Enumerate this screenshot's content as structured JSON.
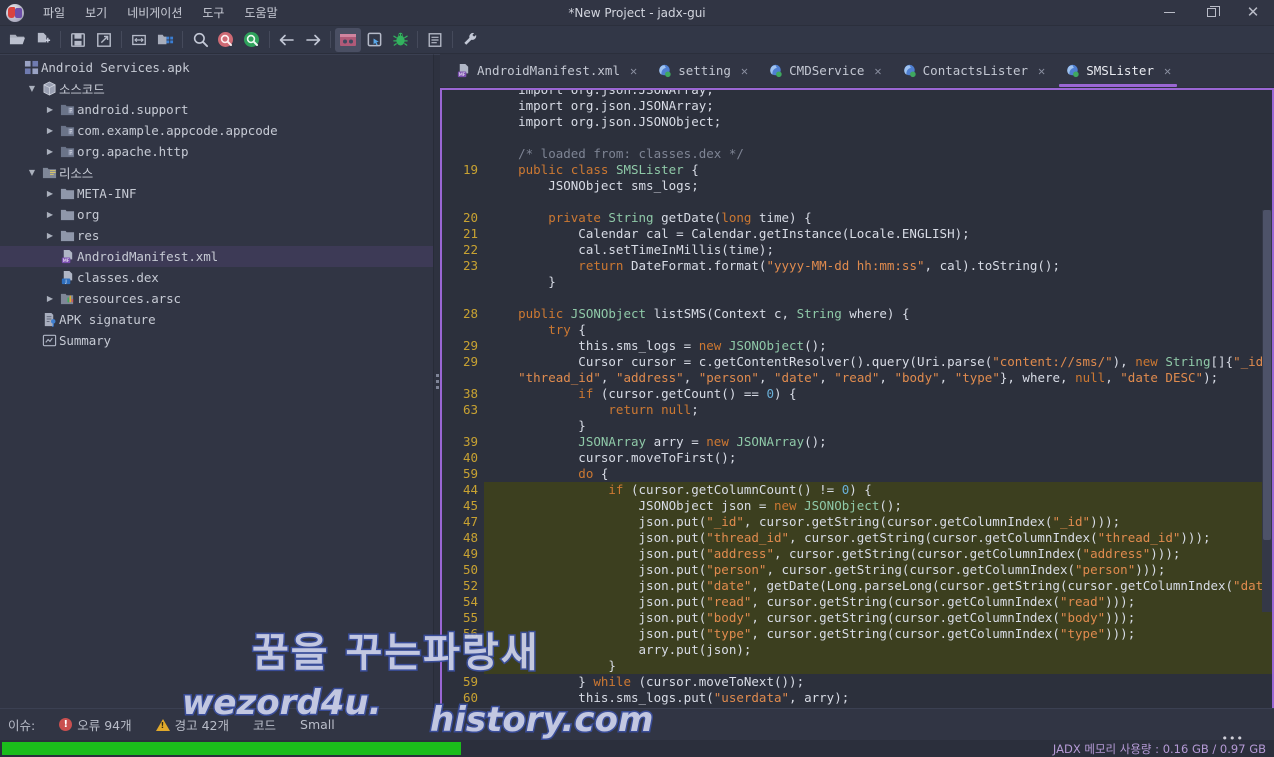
{
  "window": {
    "title": "*New Project - jadx-gui",
    "logo_icon": "jadx-logo-icon",
    "minimize_label": "−",
    "maximize_label": "□",
    "close_label": "✕"
  },
  "menubar": {
    "items": [
      {
        "label": "파일",
        "name": "menu-file"
      },
      {
        "label": "보기",
        "name": "menu-view"
      },
      {
        "label": "네비게이션",
        "name": "menu-navigation"
      },
      {
        "label": "도구",
        "name": "menu-tools"
      },
      {
        "label": "도움말",
        "name": "menu-help"
      }
    ]
  },
  "toolbar": {
    "buttons": [
      {
        "icon": "open-folder-icon"
      },
      {
        "icon": "add-files-icon"
      },
      {
        "icon": "save-icon"
      },
      {
        "icon": "export-icon"
      },
      {
        "icon": "sync-icon"
      },
      {
        "icon": "deobfuscation-icon"
      },
      {
        "icon": "search-icon"
      },
      {
        "icon": "search-class-icon"
      },
      {
        "icon": "search-comment-icon"
      },
      {
        "icon": "back-arrow-icon"
      },
      {
        "icon": "forward-arrow-icon"
      },
      {
        "icon": "quark-icon"
      },
      {
        "icon": "select-icon"
      },
      {
        "icon": "debug-bug-icon"
      },
      {
        "icon": "log-icon"
      },
      {
        "icon": "preferences-wrench-icon"
      }
    ]
  },
  "sidebar": {
    "items": [
      {
        "label": "Android Services.apk",
        "icon": "apk-icon",
        "indent": 0,
        "twisty": "",
        "selected": false
      },
      {
        "label": "소스코드",
        "icon": "package-icon",
        "indent": 1,
        "twisty": "▼",
        "selected": false
      },
      {
        "label": "android.support",
        "icon": "package-folder-icon",
        "indent": 2,
        "twisty": "▶",
        "selected": false
      },
      {
        "label": "com.example.appcode.appcode",
        "icon": "package-folder-icon",
        "indent": 2,
        "twisty": "▶",
        "selected": false
      },
      {
        "label": "org.apache.http",
        "icon": "package-folder-icon",
        "indent": 2,
        "twisty": "▶",
        "selected": false
      },
      {
        "label": "리소스",
        "icon": "resources-icon",
        "indent": 1,
        "twisty": "▼",
        "selected": false
      },
      {
        "label": "META-INF",
        "icon": "folder-icon",
        "indent": 2,
        "twisty": "▶",
        "selected": false
      },
      {
        "label": "org",
        "icon": "folder-icon",
        "indent": 2,
        "twisty": "▶",
        "selected": false
      },
      {
        "label": "res",
        "icon": "folder-icon",
        "indent": 2,
        "twisty": "▶",
        "selected": false
      },
      {
        "label": "AndroidManifest.xml",
        "icon": "manifest-file-icon",
        "indent": 2,
        "twisty": "",
        "selected": true
      },
      {
        "label": "classes.dex",
        "icon": "dex-file-icon",
        "indent": 2,
        "twisty": "",
        "selected": false
      },
      {
        "label": "resources.arsc",
        "icon": "arsc-file-icon",
        "indent": 2,
        "twisty": "▶",
        "selected": false
      },
      {
        "label": "APK signature",
        "icon": "signature-icon",
        "indent": 1,
        "twisty": "",
        "selected": false
      },
      {
        "label": "Summary",
        "icon": "summary-icon",
        "indent": 1,
        "twisty": "",
        "selected": false
      }
    ]
  },
  "tabs": [
    {
      "label": "AndroidManifest.xml",
      "icon": "manifest-file-icon",
      "active": false,
      "close": "✕"
    },
    {
      "label": "setting",
      "icon": "java-class-icon",
      "active": false,
      "close": "✕"
    },
    {
      "label": "CMDService",
      "icon": "java-class-icon",
      "active": false,
      "close": "✕"
    },
    {
      "label": "ContactsLister",
      "icon": "java-class-icon",
      "active": false,
      "close": "✕"
    },
    {
      "label": "SMSLister",
      "icon": "java-class-icon",
      "active": true,
      "close": "✕"
    }
  ],
  "code": {
    "lines": [
      {
        "n": "",
        "hl": false,
        "t": [
          [
            "plain",
            "    import org.json.JSONArray;"
          ]
        ]
      },
      {
        "n": "",
        "hl": false,
        "t": [
          [
            "plain",
            "    import org.json.JSONArray;"
          ]
        ]
      },
      {
        "n": "",
        "hl": false,
        "t": [
          [
            "plain",
            "    import org.json.JSONObject;"
          ]
        ]
      },
      {
        "n": "",
        "hl": false,
        "t": [
          [
            "plain",
            ""
          ]
        ]
      },
      {
        "n": "",
        "hl": false,
        "t": [
          [
            "cmt",
            "    /* loaded from: classes.dex */"
          ]
        ]
      },
      {
        "n": "19",
        "hl": false,
        "t": [
          [
            "kw",
            "    public "
          ],
          [
            "kw",
            "class "
          ],
          [
            "type",
            "SMSLister"
          ],
          [
            "plain",
            " {"
          ]
        ]
      },
      {
        "n": "",
        "hl": false,
        "t": [
          [
            "plain",
            "        JSONObject sms_logs;"
          ]
        ]
      },
      {
        "n": "",
        "hl": false,
        "t": [
          [
            "plain",
            ""
          ]
        ]
      },
      {
        "n": "20",
        "hl": false,
        "t": [
          [
            "kw",
            "        private "
          ],
          [
            "type",
            "String"
          ],
          [
            "plain",
            " getDate("
          ],
          [
            "kw",
            "long"
          ],
          [
            "plain",
            " time) {"
          ]
        ]
      },
      {
        "n": "21",
        "hl": false,
        "t": [
          [
            "plain",
            "            Calendar cal = Calendar.getInstance(Locale.ENGLISH);"
          ]
        ]
      },
      {
        "n": "22",
        "hl": false,
        "t": [
          [
            "plain",
            "            cal.setTimeInMillis(time);"
          ]
        ]
      },
      {
        "n": "23",
        "hl": false,
        "t": [
          [
            "kw",
            "            return "
          ],
          [
            "plain",
            "DateFormat.format("
          ],
          [
            "str",
            "\"yyyy-MM-dd hh:mm:ss\""
          ],
          [
            "plain",
            ", cal).toString();"
          ]
        ]
      },
      {
        "n": "",
        "hl": false,
        "t": [
          [
            "plain",
            "        }"
          ]
        ]
      },
      {
        "n": "",
        "hl": false,
        "t": [
          [
            "plain",
            ""
          ]
        ]
      },
      {
        "n": "28",
        "hl": false,
        "t": [
          [
            "kw",
            "    public "
          ],
          [
            "type",
            "JSONObject"
          ],
          [
            "plain",
            " listSMS(Context c, "
          ],
          [
            "type",
            "String"
          ],
          [
            "plain",
            " where) {"
          ]
        ]
      },
      {
        "n": "",
        "hl": false,
        "t": [
          [
            "kw",
            "        try"
          ],
          [
            "plain",
            " {"
          ]
        ]
      },
      {
        "n": "29",
        "hl": false,
        "t": [
          [
            "plain",
            "            this.sms_logs = "
          ],
          [
            "kw",
            "new "
          ],
          [
            "type",
            "JSONObject"
          ],
          [
            "plain",
            "();"
          ]
        ]
      },
      {
        "n": "29",
        "hl": false,
        "t": [
          [
            "plain",
            "            Cursor cursor = c.getContentResolver().query(Uri.parse("
          ],
          [
            "str",
            "\"content://sms/\""
          ],
          [
            "plain",
            "), "
          ],
          [
            "kw",
            "new "
          ],
          [
            "type",
            "String"
          ],
          [
            "plain",
            "[]{"
          ],
          [
            "str",
            "\"_id\""
          ],
          [
            "plain",
            ","
          ]
        ]
      },
      {
        "n": "",
        "hl": false,
        "t": [
          [
            "str",
            "    \"thread_id\""
          ],
          [
            "plain",
            ", "
          ],
          [
            "str",
            "\"address\""
          ],
          [
            "plain",
            ", "
          ],
          [
            "str",
            "\"person\""
          ],
          [
            "plain",
            ", "
          ],
          [
            "str",
            "\"date\""
          ],
          [
            "plain",
            ", "
          ],
          [
            "str",
            "\"read\""
          ],
          [
            "plain",
            ", "
          ],
          [
            "str",
            "\"body\""
          ],
          [
            "plain",
            ", "
          ],
          [
            "str",
            "\"type\""
          ],
          [
            "plain",
            "}, where, "
          ],
          [
            "kw",
            "null"
          ],
          [
            "plain",
            ", "
          ],
          [
            "str",
            "\"date DESC\""
          ],
          [
            "plain",
            ");"
          ]
        ]
      },
      {
        "n": "38",
        "hl": false,
        "t": [
          [
            "kw",
            "            if"
          ],
          [
            "plain",
            " (cursor.getCount() == "
          ],
          [
            "num",
            "0"
          ],
          [
            "plain",
            ") {"
          ]
        ]
      },
      {
        "n": "63",
        "hl": false,
        "t": [
          [
            "kw",
            "                return "
          ],
          [
            "kw",
            "null"
          ],
          [
            "plain",
            ";"
          ]
        ]
      },
      {
        "n": "",
        "hl": false,
        "t": [
          [
            "plain",
            "            }"
          ]
        ]
      },
      {
        "n": "39",
        "hl": false,
        "t": [
          [
            "type",
            "            JSONArray"
          ],
          [
            "plain",
            " arry = "
          ],
          [
            "kw",
            "new "
          ],
          [
            "type",
            "JSONArray"
          ],
          [
            "plain",
            "();"
          ]
        ]
      },
      {
        "n": "40",
        "hl": false,
        "t": [
          [
            "plain",
            "            cursor.moveToFirst();"
          ]
        ]
      },
      {
        "n": "59",
        "hl": false,
        "t": [
          [
            "kw",
            "            do"
          ],
          [
            "plain",
            " {"
          ]
        ]
      },
      {
        "n": "44",
        "hl": true,
        "t": [
          [
            "kw",
            "                if"
          ],
          [
            "plain",
            " (cursor.getColumnCount() != "
          ],
          [
            "num",
            "0"
          ],
          [
            "plain",
            ") {"
          ]
        ]
      },
      {
        "n": "45",
        "hl": true,
        "t": [
          [
            "plain",
            "                    JSONObject json = "
          ],
          [
            "kw",
            "new "
          ],
          [
            "type",
            "JSONObject"
          ],
          [
            "plain",
            "();"
          ]
        ]
      },
      {
        "n": "47",
        "hl": true,
        "t": [
          [
            "plain",
            "                    json.put("
          ],
          [
            "str",
            "\"_id\""
          ],
          [
            "plain",
            ", cursor.getString(cursor.getColumnIndex("
          ],
          [
            "str",
            "\"_id\""
          ],
          [
            "plain",
            ")));"
          ]
        ]
      },
      {
        "n": "48",
        "hl": true,
        "t": [
          [
            "plain",
            "                    json.put("
          ],
          [
            "str",
            "\"thread_id\""
          ],
          [
            "plain",
            ", cursor.getString(cursor.getColumnIndex("
          ],
          [
            "str",
            "\"thread_id\""
          ],
          [
            "plain",
            ")));"
          ]
        ]
      },
      {
        "n": "49",
        "hl": true,
        "t": [
          [
            "plain",
            "                    json.put("
          ],
          [
            "str",
            "\"address\""
          ],
          [
            "plain",
            ", cursor.getString(cursor.getColumnIndex("
          ],
          [
            "str",
            "\"address\""
          ],
          [
            "plain",
            ")));"
          ]
        ]
      },
      {
        "n": "50",
        "hl": true,
        "t": [
          [
            "plain",
            "                    json.put("
          ],
          [
            "str",
            "\"person\""
          ],
          [
            "plain",
            ", cursor.getString(cursor.getColumnIndex("
          ],
          [
            "str",
            "\"person\""
          ],
          [
            "plain",
            ")));"
          ]
        ]
      },
      {
        "n": "52",
        "hl": true,
        "t": [
          [
            "plain",
            "                    json.put("
          ],
          [
            "str",
            "\"date\""
          ],
          [
            "plain",
            ", getDate(Long.parseLong(cursor.getString(cursor.getColumnIndex("
          ],
          [
            "str",
            "\"date\""
          ],
          [
            "plain",
            ")))));"
          ]
        ]
      },
      {
        "n": "54",
        "hl": true,
        "t": [
          [
            "plain",
            "                    json.put("
          ],
          [
            "str",
            "\"read\""
          ],
          [
            "plain",
            ", cursor.getString(cursor.getColumnIndex("
          ],
          [
            "str",
            "\"read\""
          ],
          [
            "plain",
            ")));"
          ]
        ]
      },
      {
        "n": "55",
        "hl": true,
        "t": [
          [
            "plain",
            "                    json.put("
          ],
          [
            "str",
            "\"body\""
          ],
          [
            "plain",
            ", cursor.getString(cursor.getColumnIndex("
          ],
          [
            "str",
            "\"body\""
          ],
          [
            "plain",
            ")));"
          ]
        ]
      },
      {
        "n": "56",
        "hl": true,
        "t": [
          [
            "plain",
            "                    json.put("
          ],
          [
            "str",
            "\"type\""
          ],
          [
            "plain",
            ", cursor.getString(cursor.getColumnIndex("
          ],
          [
            "str",
            "\"type\""
          ],
          [
            "plain",
            ")));"
          ]
        ]
      },
      {
        "n": "",
        "hl": true,
        "t": [
          [
            "plain",
            "                    arry.put(json);"
          ]
        ]
      },
      {
        "n": "",
        "hl": true,
        "t": [
          [
            "plain",
            "                }"
          ]
        ]
      },
      {
        "n": "59",
        "hl": false,
        "t": [
          [
            "plain",
            "            } "
          ],
          [
            "kw",
            "while"
          ],
          [
            "plain",
            " (cursor.moveToNext());"
          ]
        ]
      },
      {
        "n": "60",
        "hl": false,
        "t": [
          [
            "plain",
            "            this.sms_logs.put("
          ],
          [
            "str",
            "\"userdata\""
          ],
          [
            "plain",
            ", arry);"
          ]
        ]
      },
      {
        "n": "",
        "hl": false,
        "t": [
          [
            "plain",
            "            }"
          ]
        ]
      }
    ]
  },
  "statusbar": {
    "issues_label": "이슈:",
    "errors_text": "오류 94개",
    "warnings_text": "경고 42개",
    "code_label": "코드",
    "size_label": "Small",
    "error_glyph": "!",
    "memory_text": "JADX 메모리 사용량 : 0.16 GB / 0.97 GB",
    "dots": "•••",
    "progress_percent": 36
  },
  "watermark": {
    "line1": "꿈을 꾸는파랑새",
    "line2": "wezord4u.",
    "line3": "history.com"
  },
  "colors": {
    "accent": "#9a66d4",
    "error": "#c94f4f",
    "warning": "#e0a92b",
    "progress": "#1bbd1b",
    "editor_bg": "#2c303c",
    "panel_bg": "#313544",
    "highlight": "#3c3f1f",
    "gutter_text": "#c8a232"
  }
}
